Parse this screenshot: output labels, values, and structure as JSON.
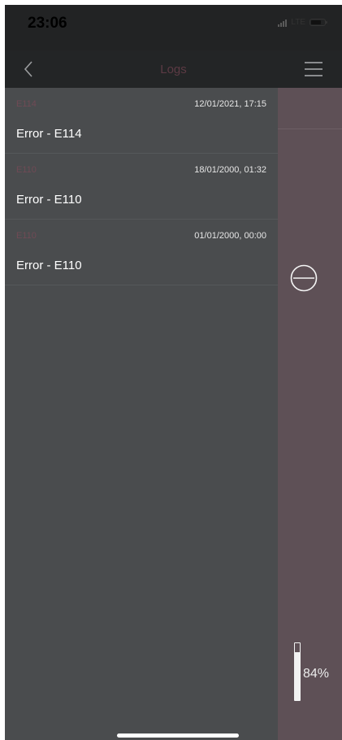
{
  "status_bar": {
    "time": "23:06",
    "network": "LTE"
  },
  "nav": {
    "title": "Logs",
    "back_icon": "chevron-left-icon",
    "menu_icon": "hamburger-menu-icon",
    "title_color": "#5c3a44"
  },
  "logs": [
    {
      "code": "E114",
      "date": "12/01/2021, 17:15",
      "message": "Error - E114"
    },
    {
      "code": "E110",
      "date": "18/01/2000, 01:32",
      "message": "Error - E110"
    },
    {
      "code": "E110",
      "date": "01/01/2000, 00:00",
      "message": "Error - E110"
    }
  ],
  "side_panel": {
    "minus_icon": "minus-circle-icon",
    "battery_label": "84%",
    "battery_level": 0.84,
    "accent": "#5e5056"
  }
}
